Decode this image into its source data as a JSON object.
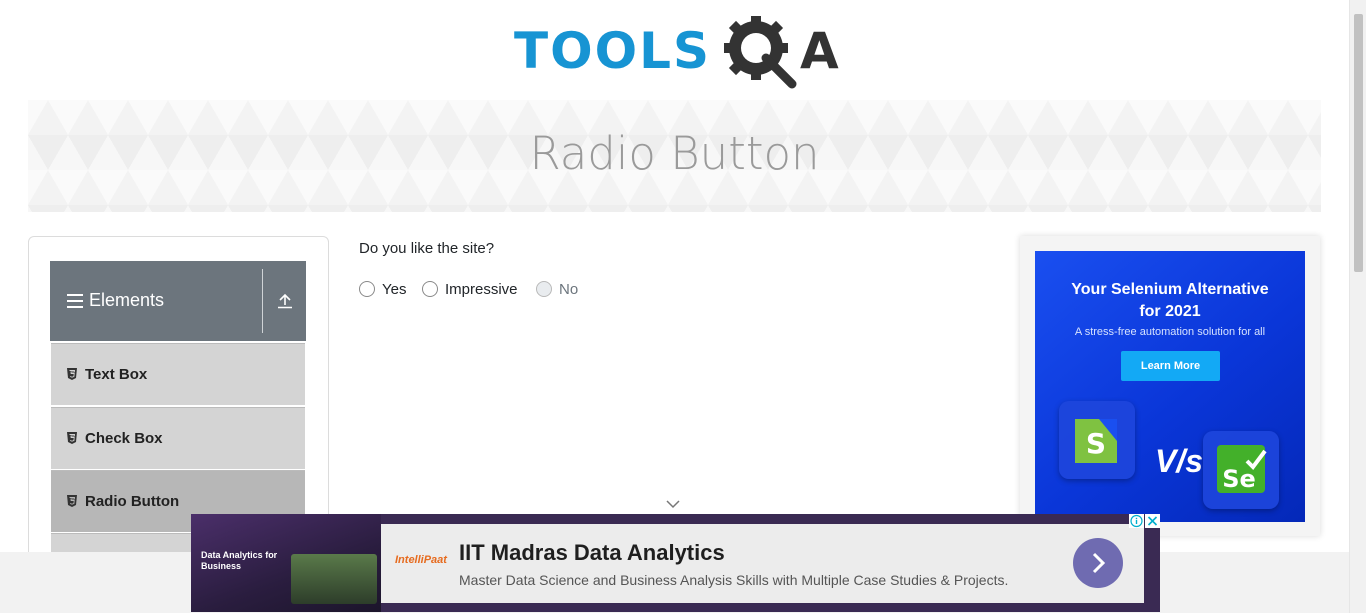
{
  "logo": {
    "left_text": "TOOLS",
    "right_text": "A"
  },
  "banner": {
    "title": "Radio Button"
  },
  "sidebar": {
    "group_title": "Elements",
    "items": [
      {
        "label": "Text Box",
        "active": false
      },
      {
        "label": "Check Box",
        "active": false
      },
      {
        "label": "Radio Button",
        "active": true
      }
    ]
  },
  "form": {
    "question": "Do you like the site?",
    "options": [
      {
        "label": "Yes",
        "disabled": false
      },
      {
        "label": "Impressive",
        "disabled": false
      },
      {
        "label": "No",
        "disabled": true
      }
    ]
  },
  "right_ad": {
    "headline_line1": "Your Selenium Alternative",
    "headline_line2": "for 2021",
    "subtext": "A stress-free automation solution for all",
    "button_label": "Learn More",
    "vs_text": "V/s"
  },
  "bottom_ad": {
    "brand": "IntelliPaat",
    "title": "IIT Madras Data Analytics",
    "description": "Master Data Science and Business Analysis Skills with Multiple Case Studies & Projects.",
    "image_caption": "Data Analytics for Business"
  },
  "colors": {
    "brand_blue": "#1794d3",
    "sidebar_header": "#6c757d",
    "ad_blue": "#0a36d8"
  },
  "icons": [
    "hamburger-icon",
    "upload-icon",
    "html5-icon",
    "chevron-down-icon",
    "arrow-right-icon",
    "info-icon",
    "close-icon",
    "gear-search-icon"
  ]
}
